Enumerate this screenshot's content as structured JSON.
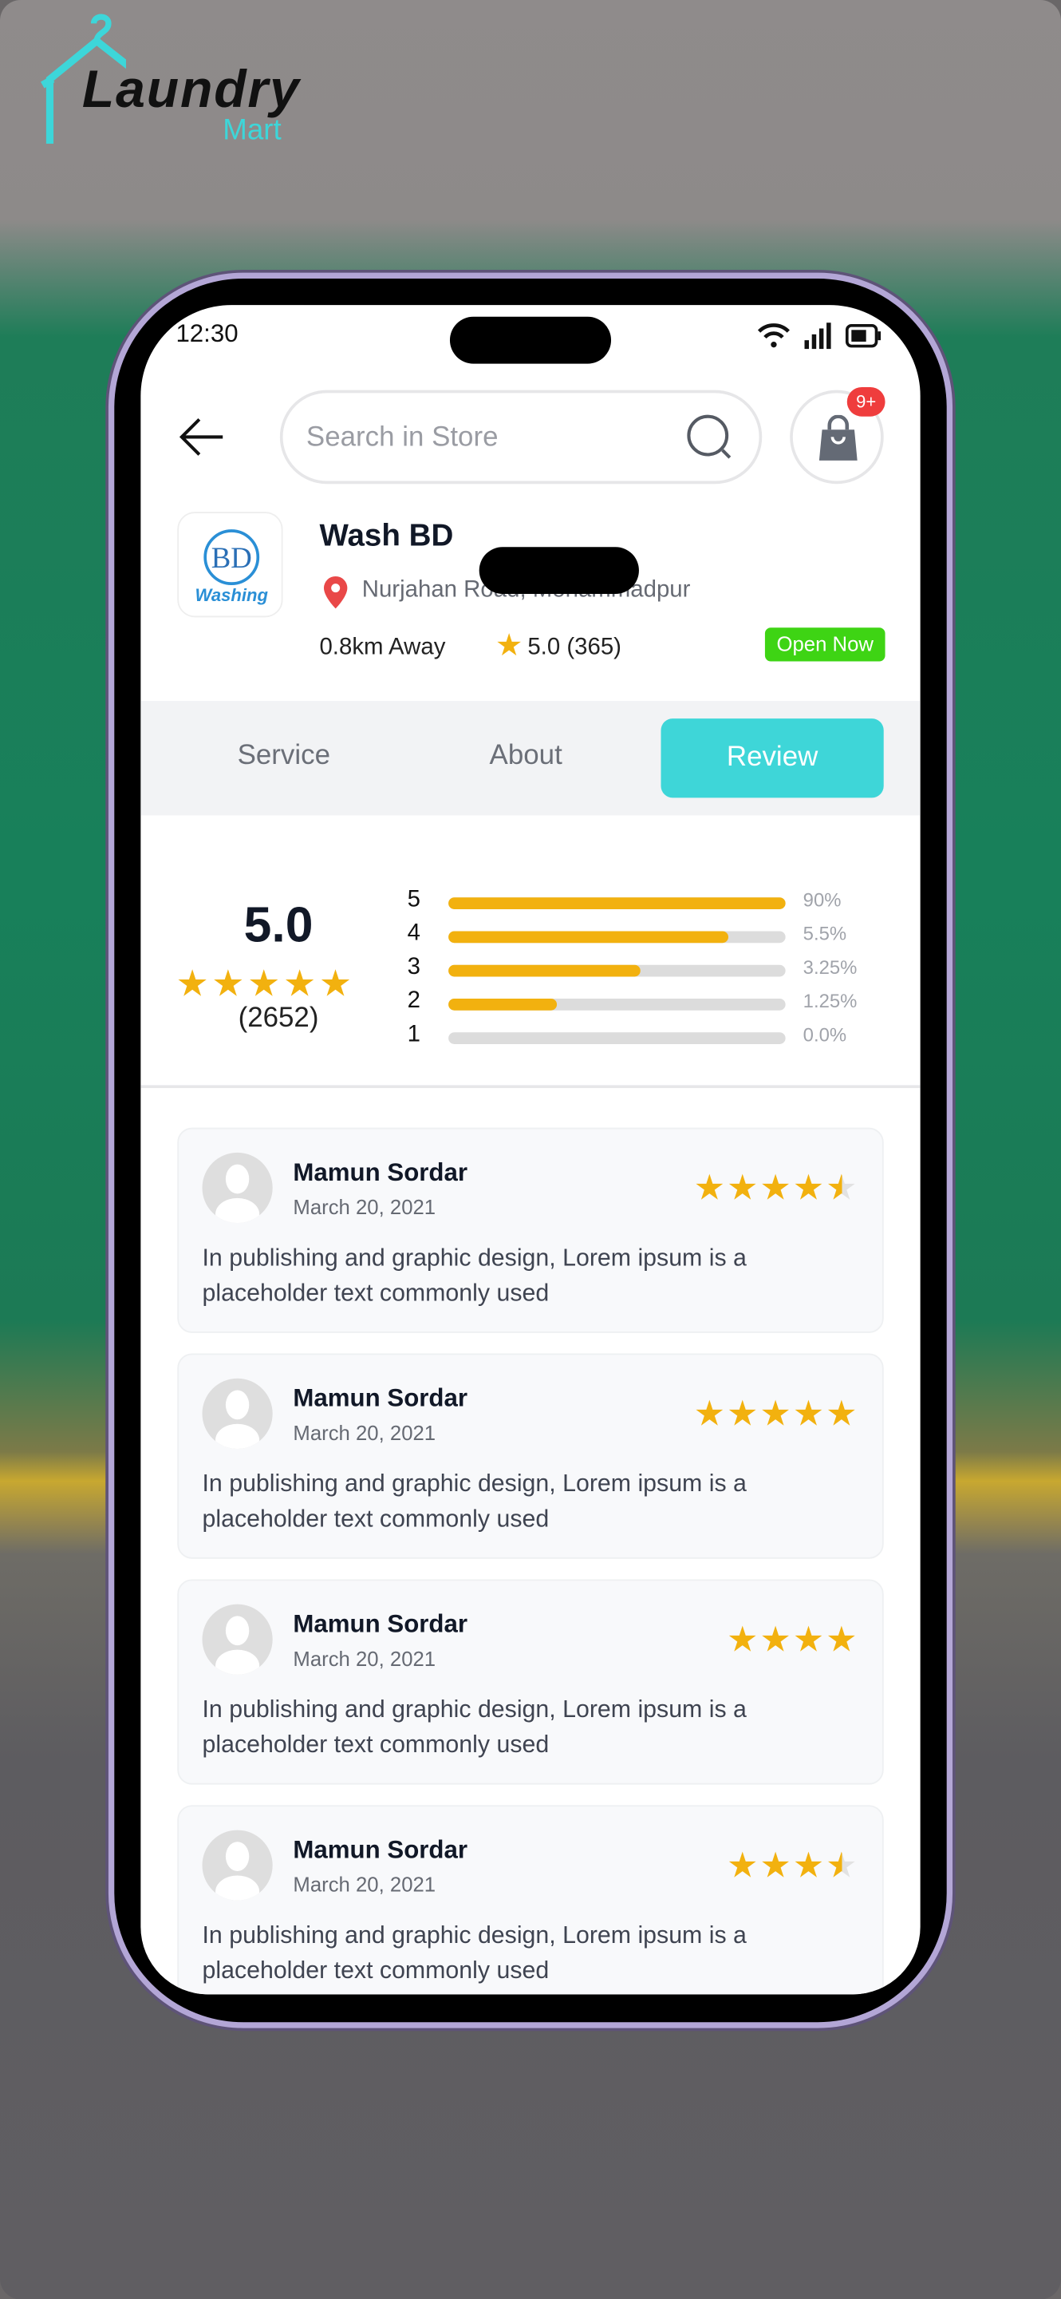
{
  "brand": {
    "logo_text": "Laundry",
    "logo_sub": "Mart",
    "accent": "#3ed6d8"
  },
  "status_bar": {
    "time": "12:30"
  },
  "header": {
    "search_placeholder": "Search in Store",
    "cart_badge": "9+"
  },
  "store": {
    "name": "Wash BD",
    "logo_text": "BD",
    "logo_sub": "Washing",
    "location": "Nurjahan Road, Mohammadpur",
    "distance": "0.8km Away",
    "rating": "5.0 (365)",
    "status": "Open Now",
    "status_color": "#3ed414"
  },
  "tabs": [
    {
      "label": "Service"
    },
    {
      "label": "About"
    },
    {
      "label": "Review",
      "active": true
    }
  ],
  "summary": {
    "score": "5.0",
    "stars": 5,
    "count": "(2652)",
    "breakdown": [
      {
        "star": "5",
        "pct": "90%",
        "fill": 100
      },
      {
        "star": "4",
        "pct": "5.5%",
        "fill": 83
      },
      {
        "star": "3",
        "pct": "3.25%",
        "fill": 57
      },
      {
        "star": "2",
        "pct": "1.25%",
        "fill": 32
      },
      {
        "star": "1",
        "pct": "0.0%",
        "fill": 0
      }
    ]
  },
  "reviews": [
    {
      "name": "Mamun Sordar",
      "date": "March 20, 2021",
      "text": "In publishing and graphic design, Lorem ipsum is a placeholder text commonly used",
      "rating": 4.5
    },
    {
      "name": "Mamun Sordar",
      "date": "March 20, 2021",
      "text": "In publishing and graphic design, Lorem ipsum is a placeholder text commonly used",
      "rating": 5
    },
    {
      "name": "Mamun Sordar",
      "date": "March 20, 2021",
      "text": "In publishing and graphic design, Lorem ipsum is a placeholder text commonly used",
      "rating": 4
    },
    {
      "name": "Mamun Sordar",
      "date": "March 20, 2021",
      "text": "In publishing and graphic design, Lorem ipsum is a placeholder text commonly used",
      "rating": 3.5
    }
  ]
}
